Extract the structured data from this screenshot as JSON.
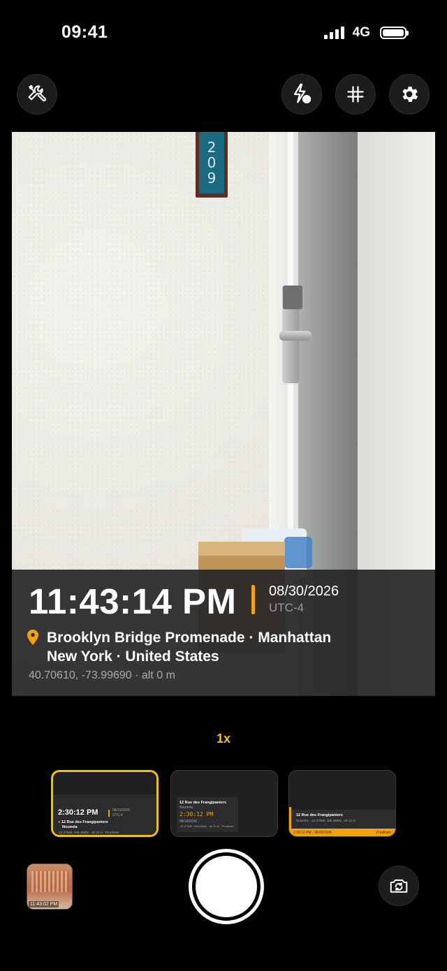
{
  "status_bar": {
    "time": "09:41",
    "network": "4G"
  },
  "toolbar": {
    "tools_icon": "wrench-screwdriver-icon",
    "flash_icon": "flash-auto-icon",
    "grid_icon": "grid-hash-icon",
    "settings_icon": "gear-icon"
  },
  "viewfinder": {
    "scene_plaque": [
      "2",
      "0",
      "9"
    ]
  },
  "stamp": {
    "time": "11:43:14 PM",
    "date": "08/30/2026",
    "timezone": "UTC-4",
    "location_line1": "Brooklyn Bridge Promenade · Manhattan",
    "location_line2": "New York · United States",
    "coords": "40.70610, -73.99690 · alt 0 m",
    "accent": "#f2a20c"
  },
  "zoom": "1x",
  "templates": [
    {
      "time": "2:30:12 PM",
      "date": "08/19/2026",
      "tz": "UTC-4",
      "place": "12 Rue des Frangipaniers",
      "city": "Nouméa",
      "coords": "-22.27580, 166.45800 · alt 12 m · Proofcam",
      "selected": true
    },
    {
      "place": "12 Rue des Frangipaniers",
      "city": "Nouméa",
      "time": "2:30:12 PM",
      "date": "08/19/2026",
      "coords": "-22.27580, 166.45800 · alt 12 m · Proofcam"
    },
    {
      "place": "12 Rue des Frangipaniers",
      "line2": "Nouméa · -22.27580, 166.45800 · alt 12 m",
      "footer": "2:30:12 PM · 08/19/2026",
      "brand": "Proofcam"
    }
  ],
  "last_photo": {
    "label": "11:43:02 PM"
  },
  "accent_yellow": "#f4c21a"
}
